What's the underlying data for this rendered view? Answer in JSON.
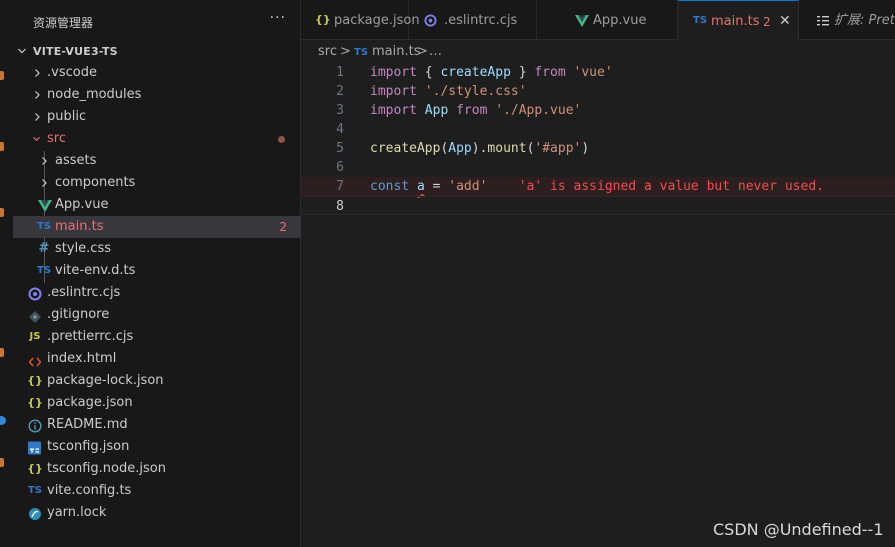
{
  "explorer": {
    "title": "资源管理器",
    "more": "···",
    "root": "VITE-VUE3-TS",
    "items": [
      {
        "label": ".vscode",
        "type": "folder",
        "icon": "chevron-right-icon"
      },
      {
        "label": "node_modules",
        "type": "folder",
        "icon": "chevron-right-icon"
      },
      {
        "label": "public",
        "type": "folder",
        "icon": "chevron-right-icon"
      },
      {
        "label": "src",
        "type": "folder-open",
        "icon": "chevron-down-icon"
      },
      {
        "label": "assets",
        "type": "folder",
        "icon": "chevron-right-icon"
      },
      {
        "label": "components",
        "type": "folder",
        "icon": "chevron-right-icon"
      },
      {
        "label": "App.vue",
        "icon": "vue-icon"
      },
      {
        "label": "main.ts",
        "icon": "ts-icon",
        "badge": "2"
      },
      {
        "label": "style.css",
        "icon": "css-hash-icon",
        "icon_text": "#"
      },
      {
        "label": "vite-env.d.ts",
        "icon": "ts-icon"
      },
      {
        "label": ".eslintrc.cjs",
        "icon": "eslint-icon"
      },
      {
        "label": ".gitignore",
        "icon": "git-icon"
      },
      {
        "label": ".prettierrc.cjs",
        "icon": "js-icon"
      },
      {
        "label": "index.html",
        "icon": "html-icon"
      },
      {
        "label": "package-lock.json",
        "icon": "json-icon"
      },
      {
        "label": "package.json",
        "icon": "json-icon"
      },
      {
        "label": "README.md",
        "icon": "info-icon"
      },
      {
        "label": "tsconfig.json",
        "icon": "tsconfig-icon"
      },
      {
        "label": "tsconfig.node.json",
        "icon": "json-icon"
      },
      {
        "label": "vite.config.ts",
        "icon": "ts-icon"
      },
      {
        "label": "yarn.lock",
        "icon": "yarn-icon"
      }
    ]
  },
  "icon_text": {
    "ts": "TS",
    "js": "JS",
    "json": "{}",
    "css": "#"
  },
  "tabs": [
    {
      "label": "package.json",
      "icon": "json-icon"
    },
    {
      "label": ".eslintrc.cjs",
      "icon": "eslint-icon"
    },
    {
      "label": "App.vue",
      "icon": "vue-icon"
    },
    {
      "label": "main.ts",
      "icon": "ts-icon",
      "badge": "2",
      "close": "✕",
      "active": true
    },
    {
      "label": "扩展: Prettie",
      "icon": "extension-icon"
    }
  ],
  "breadcrumb": {
    "folder": "src",
    "sep": ">",
    "file": "main.ts",
    "more": "…"
  },
  "editor": {
    "line_numbers": [
      "1",
      "2",
      "3",
      "4",
      "5",
      "6",
      "7",
      "8"
    ],
    "lines": {
      "l1": {
        "kw": "import",
        "p1": " { ",
        "name": "createApp",
        "p2": " } ",
        "from": "from",
        "sp": " ",
        "src": "'vue'"
      },
      "l2": {
        "kw": "import",
        "sp": " ",
        "src": "'./style.css'"
      },
      "l3": {
        "kw": "import",
        "sp": " ",
        "name": "App",
        "sp2": " ",
        "from": "from",
        "sp3": " ",
        "src": "'./App.vue'"
      },
      "l5": {
        "fn": "createApp",
        "p1": "(",
        "arg": "App",
        "p2": ").",
        "method": "mount",
        "p3": "(",
        "str": "'#app'",
        "p4": ")"
      },
      "l7": {
        "kw": "const",
        "sp": " ",
        "var": "a",
        "p1": " = ",
        "str": "'add'",
        "gap": "    ",
        "diagnostic": "'a' is assigned a value but never used."
      }
    }
  },
  "watermark": "CSDN @Undefined--1",
  "colors": {
    "error": "#f14c4c",
    "accent": "#0078d4",
    "vue": "#41b883",
    "ts": "#3178c6",
    "json": "#cbcb41"
  }
}
